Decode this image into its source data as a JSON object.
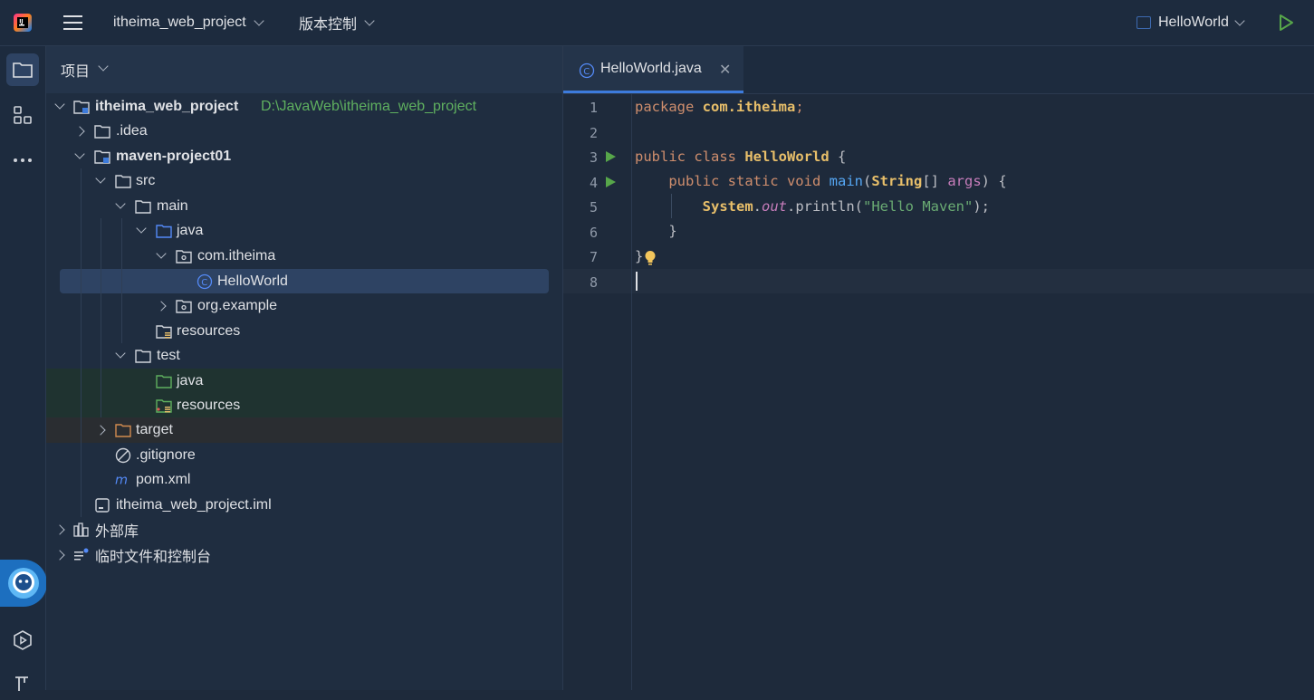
{
  "titlebar": {
    "project_name": "itheima_web_project",
    "vcs_label": "版本控制",
    "run_config": "HelloWorld"
  },
  "project_panel": {
    "title": "项目",
    "tree": [
      {
        "label": "itheima_web_project",
        "path": "D:\\JavaWeb\\itheima_web_project",
        "bold": true
      },
      {
        "label": ".idea"
      },
      {
        "label": "maven-project01",
        "bold": true
      },
      {
        "label": "src"
      },
      {
        "label": "main"
      },
      {
        "label": "java"
      },
      {
        "label": "com.itheima"
      },
      {
        "label": "HelloWorld",
        "selected": true
      },
      {
        "label": "org.example"
      },
      {
        "label": "resources"
      },
      {
        "label": "test"
      },
      {
        "label": "java"
      },
      {
        "label": "resources"
      },
      {
        "label": "target"
      },
      {
        "label": ".gitignore"
      },
      {
        "label": "pom.xml"
      },
      {
        "label": "itheima_web_project.iml"
      },
      {
        "label": "外部库"
      },
      {
        "label": "临时文件和控制台"
      }
    ]
  },
  "editor": {
    "tab_label": "HelloWorld.java",
    "line_numbers": [
      "1",
      "2",
      "3",
      "4",
      "5",
      "6",
      "7",
      "8"
    ],
    "code": {
      "l1_kw": "package",
      "l1_pkg": "com.itheima",
      "l1_semi": ";",
      "l3_kw": "public class",
      "l3_cls": "HelloWorld",
      "l3_brace": " {",
      "l4_kw": "public static void",
      "l4_mth": "main",
      "l4_open": "(",
      "l4_type": "String",
      "l4_arr": "[] ",
      "l4_prm": "args",
      "l4_close": ") {",
      "l5_cls": "System",
      "l5_dot": ".",
      "l5_fld": "out",
      "l5_call": ".println(",
      "l5_str": "\"Hello Maven\"",
      "l5_end": ");",
      "l6": "}",
      "l7": "}"
    }
  },
  "colors": {
    "accent": "#3d7bdc",
    "run_green": "#57a64a",
    "folder_blue": "#548af7",
    "test_green": "#5fb05f",
    "excluded_orange": "#d18b4f"
  }
}
